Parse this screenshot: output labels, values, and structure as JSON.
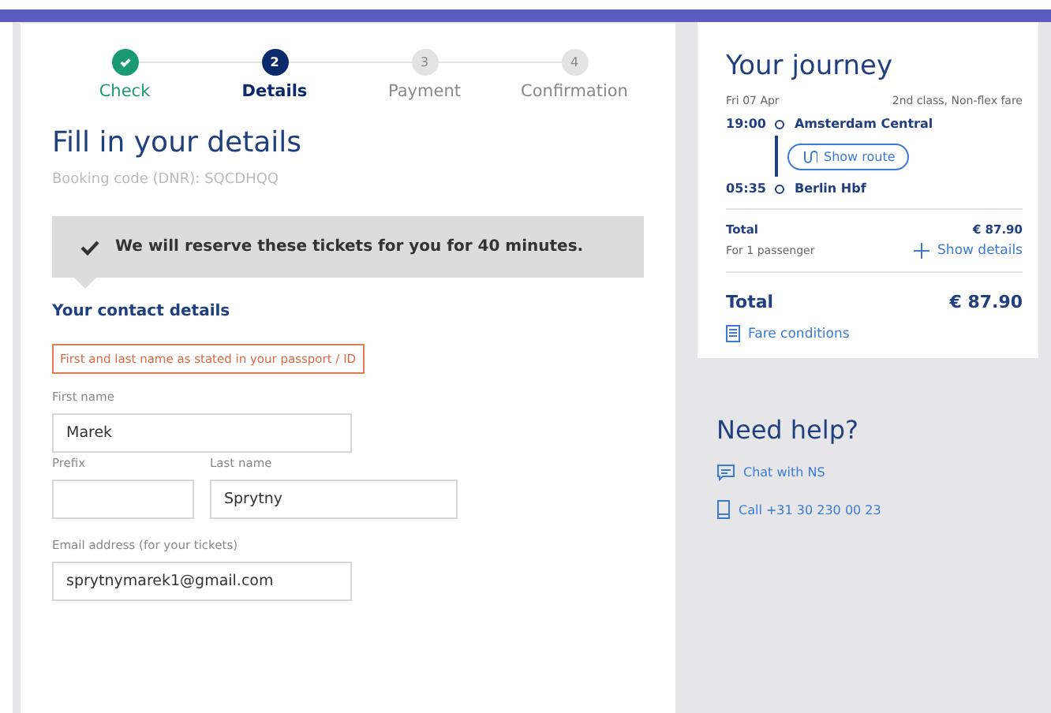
{
  "steps": [
    {
      "label": "Check",
      "done": true,
      "selected": false
    },
    {
      "number": "2",
      "label": "Details",
      "done": false,
      "selected": true
    },
    {
      "number": "3",
      "label": "Payment",
      "done": false,
      "selected": false
    },
    {
      "number": "4",
      "label": "Confirmation",
      "done": false,
      "selected": false
    }
  ],
  "form": {
    "title": "Fill in your details",
    "booking_code": "Booking code (DNR): SQCDHQQ",
    "notice": "We will reserve these tickets for you for 40 minutes.",
    "section_title": "Your contact details",
    "warning": "First and last name as stated in your passport / ID",
    "first_name": {
      "label": "First name",
      "value": "Marek"
    },
    "prefix": {
      "label": "Prefix"
    },
    "last_name": {
      "label": "Last name",
      "value": "Sprytny"
    },
    "email": {
      "label": "Email address (for your tickets)",
      "value": "sprytnymarek1@gmail.com"
    }
  },
  "journey": {
    "title": "Your journey",
    "date": "Fri 07 Apr",
    "fare": "2nd class, Non-flex fare",
    "departure": {
      "time": "19:00",
      "station": "Amsterdam Central"
    },
    "route_button": "Show route",
    "arrival": {
      "time": "05:35",
      "station": "Berlin Hbf"
    },
    "subtotal_label": "Total",
    "subtotal_value": "€ 87.90",
    "passengers": "For 1 passenger",
    "details_link": "Show details",
    "total_label": "Total",
    "total_value": "€ 87.90",
    "conditions_link": "Fare conditions"
  },
  "help": {
    "title": "Need help?",
    "links": [
      {
        "kind": "chat",
        "label": "Chat with NS"
      },
      {
        "kind": "phone",
        "label": "Call +31 30 230 00 23"
      }
    ]
  }
}
